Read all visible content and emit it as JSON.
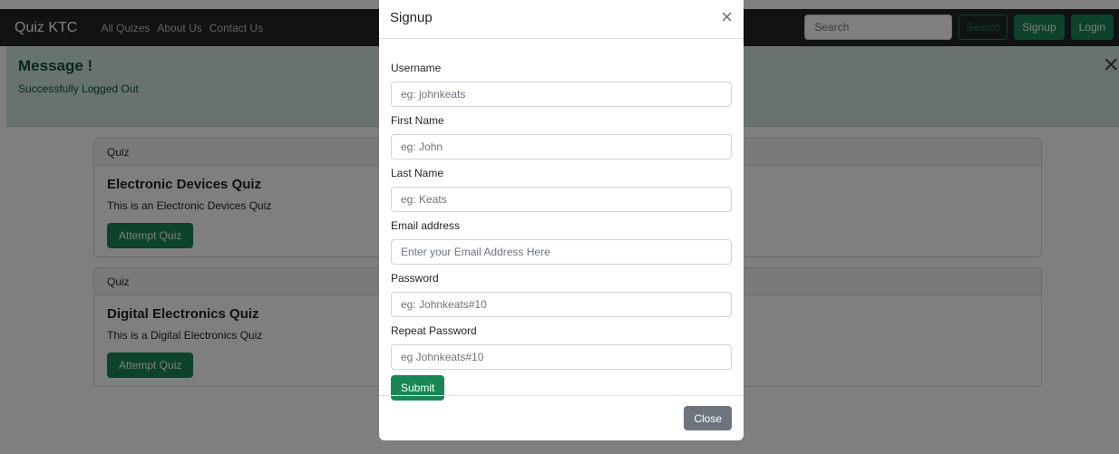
{
  "navbar": {
    "brand": "Quiz KTC",
    "links": [
      "All Quizes",
      "About Us",
      "Contact Us"
    ],
    "search_placeholder": "Search",
    "search_button": "Search",
    "signup_button": "Signup",
    "login_button": "Login"
  },
  "alert": {
    "title": "Message !",
    "text": "Successfully Logged Out",
    "close_glyph": "×"
  },
  "quizzes": [
    {
      "header": "Quiz",
      "title": "Electronic Devices Quiz",
      "description": "This is an Electronic Devices Quiz",
      "button": "Attempt Quiz"
    },
    {
      "header": "Quiz",
      "title": "Digital Electronics Quiz",
      "description": "This is a Digital Electronics Quiz",
      "button": "Attempt Quiz"
    }
  ],
  "modal": {
    "title": "Signup",
    "close_glyph": "×",
    "fields": [
      {
        "label": "Username",
        "placeholder": "eg: johnkeats"
      },
      {
        "label": "First Name",
        "placeholder": "eg: John"
      },
      {
        "label": "Last Name",
        "placeholder": "eg: Keats"
      },
      {
        "label": "Email address",
        "placeholder": "Enter your Email Address Here"
      },
      {
        "label": "Password",
        "placeholder": "eg: Johnkeats#10"
      },
      {
        "label": "Repeat Password",
        "placeholder": "eg Johnkeats#10"
      }
    ],
    "submit_button": "Submit",
    "close_button": "Close"
  },
  "colors": {
    "navbar_bg": "#212529",
    "success": "#198754",
    "alert_bg": "#d1e7dd",
    "secondary": "#6c757d"
  }
}
